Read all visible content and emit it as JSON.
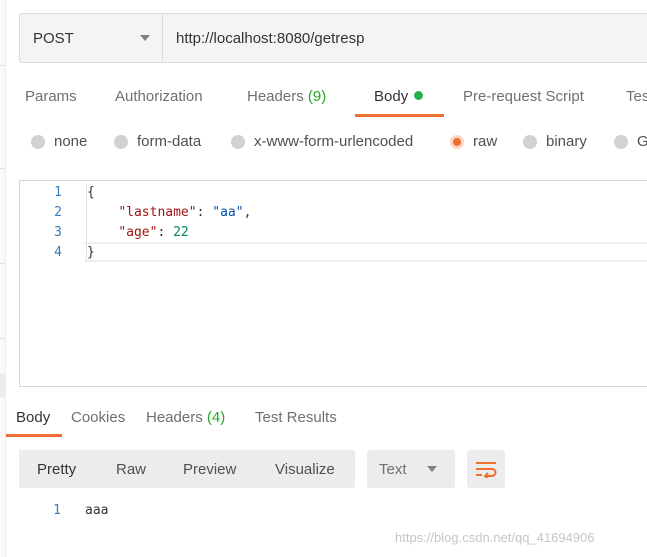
{
  "request": {
    "method": "POST",
    "url": "http://localhost:8080/getresp"
  },
  "request_tabs": [
    {
      "label": "Params"
    },
    {
      "label": "Authorization"
    },
    {
      "label": "Headers",
      "count": "(9)"
    },
    {
      "label": "Body"
    },
    {
      "label": "Pre-request Script"
    },
    {
      "label": "Tes"
    }
  ],
  "body_types": [
    {
      "label": "none"
    },
    {
      "label": "form-data"
    },
    {
      "label": "x-www-form-urlencoded"
    },
    {
      "label": "raw",
      "selected": true
    },
    {
      "label": "binary"
    },
    {
      "label": "G"
    }
  ],
  "editor": {
    "line_numbers": [
      "1",
      "2",
      "3",
      "4"
    ],
    "line1": "{",
    "line2_key": "\"lastname\"",
    "line2_sep": ": ",
    "line2_val": "\"aa\"",
    "line2_end": ",",
    "line3_key": "\"age\"",
    "line3_sep": ": ",
    "line3_val": "22",
    "line4": "}"
  },
  "response_tabs": [
    {
      "label": "Body"
    },
    {
      "label": "Cookies"
    },
    {
      "label": "Headers",
      "count": "(4)"
    },
    {
      "label": "Test Results"
    }
  ],
  "view_modes": [
    "Pretty",
    "Raw",
    "Preview",
    "Visualize"
  ],
  "format": "Text",
  "response": {
    "line_number": "1",
    "text": "aaa"
  },
  "watermark": "https://blog.csdn.net/qq_41694906",
  "colors": {
    "accent": "#f06d2f",
    "active_dot": "#26b04a",
    "count": "#26a826"
  }
}
